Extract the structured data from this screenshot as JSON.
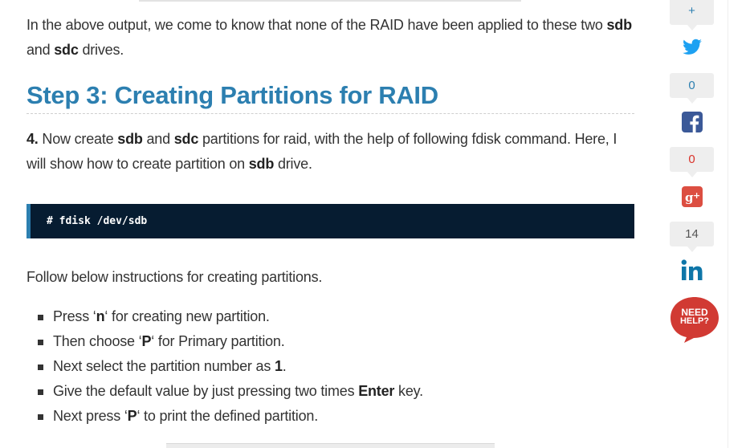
{
  "intro": {
    "text_1": "In the above output, we come to know that none of the RAID have been applied to these two ",
    "bold_1": "sdb",
    "text_2": " and ",
    "bold_2": "sdc",
    "text_3": " drives."
  },
  "section": {
    "heading": "Step 3: Creating Partitions for RAID"
  },
  "step4": {
    "number": "4.",
    "text_1": " Now create ",
    "bold_1": "sdb",
    "text_2": " and ",
    "bold_2": "sdc",
    "text_3": " partitions for raid, with the help of following fdisk command. Here, I will show how to create partition on ",
    "bold_3": "sdb",
    "text_4": " drive."
  },
  "code": {
    "command": "# fdisk /dev/sdb"
  },
  "instructions": {
    "lead": "Follow below instructions for creating partitions.",
    "items": [
      {
        "pre": "Press ‘",
        "bold": "n",
        "post": "‘ for creating new partition."
      },
      {
        "pre": "Then choose ‘",
        "bold": "P",
        "post": "‘ for Primary partition."
      },
      {
        "pre": "Next select the partition number as ",
        "bold": "1",
        "post": "."
      },
      {
        "pre": "Give the default value by just pressing two times ",
        "bold": "Enter",
        "post": " key."
      },
      {
        "pre": "Next press ‘",
        "bold": "P",
        "post": "‘ to print the defined partition."
      }
    ]
  },
  "share": {
    "twitter_count": "+",
    "facebook_count": "0",
    "googleplus_count": "0",
    "linkedin_count": "14",
    "icons": [
      "twitter-icon",
      "facebook-icon",
      "google-plus-icon",
      "linkedin-icon",
      "need-help-badge"
    ],
    "need_help_line_1": "NEED",
    "need_help_line_2": "HELP?",
    "colors": {
      "twitter": "#1da1f2",
      "facebook": "#3b5998",
      "googleplus": "#dc4e41",
      "linkedin": "#0e76a8",
      "needhelp": "#d13a33"
    }
  },
  "colors": {
    "heading": "#2c7fb0",
    "code_bg": "#061c31",
    "code_border": "#2c7fb0"
  }
}
